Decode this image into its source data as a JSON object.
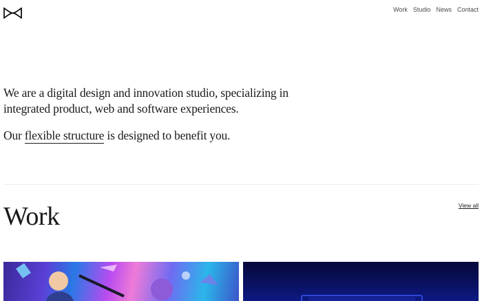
{
  "header": {
    "logo_icon": "bowtie-logo-icon",
    "nav": [
      "Work",
      "Studio",
      "News",
      "Contact"
    ]
  },
  "intro": {
    "line1": "We are a digital design and innovation studio, specializing in integrated product, web and software experiences.",
    "line2_before": "Our ",
    "line2_link": "flexible structure",
    "line2_after": " is designed to benefit you."
  },
  "work": {
    "title": "Work",
    "view_all": "View all",
    "cards": [
      {
        "image": "colorful-game-key-art-thumbnail"
      },
      {
        "image": "dark-blue-neon-thumbnail"
      }
    ]
  },
  "colors": {
    "text": "#1a1a1a",
    "nav_text": "#4a4a4a",
    "divider": "#eeeeee",
    "background": "#ffffff"
  }
}
